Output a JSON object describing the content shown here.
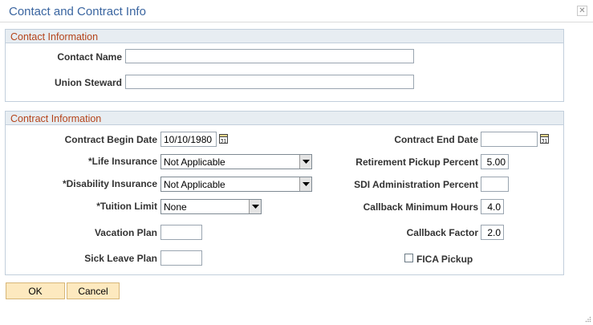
{
  "dialog": {
    "title": "Contact and Contract Info",
    "close_icon": "close-icon"
  },
  "contact_section": {
    "header": "Contact Information",
    "contact_name": {
      "label": "Contact Name",
      "value": ""
    },
    "union_steward": {
      "label": "Union Steward",
      "value": ""
    }
  },
  "contract_section": {
    "header": "Contract Information",
    "contract_begin_date": {
      "label": "Contract Begin Date",
      "value": "10/10/1980"
    },
    "life_insurance": {
      "label": "*Life Insurance",
      "value": "Not Applicable"
    },
    "disability_insurance": {
      "label": "*Disability Insurance",
      "value": "Not Applicable"
    },
    "tuition_limit": {
      "label": "*Tuition Limit",
      "value": "None"
    },
    "vacation_plan": {
      "label": "Vacation Plan",
      "value": ""
    },
    "sick_leave_plan": {
      "label": "Sick Leave Plan",
      "value": ""
    },
    "contract_end_date": {
      "label": "Contract End Date",
      "value": ""
    },
    "retirement_pickup_percent": {
      "label": "Retirement Pickup Percent",
      "value": "5.00"
    },
    "sdi_administration_percent": {
      "label": "SDI Administration Percent",
      "value": ""
    },
    "callback_minimum_hours": {
      "label": "Callback Minimum Hours",
      "value": "4.0"
    },
    "callback_factor": {
      "label": "Callback Factor",
      "value": "2.0"
    },
    "fica_pickup": {
      "label": "FICA Pickup",
      "checked": false
    }
  },
  "buttons": {
    "ok": "OK",
    "cancel": "Cancel"
  },
  "colors": {
    "title": "#3a65a0",
    "section_header_text": "#b5441b",
    "section_header_bg": "#e7edf2",
    "button_bg": "#fde9bf"
  }
}
